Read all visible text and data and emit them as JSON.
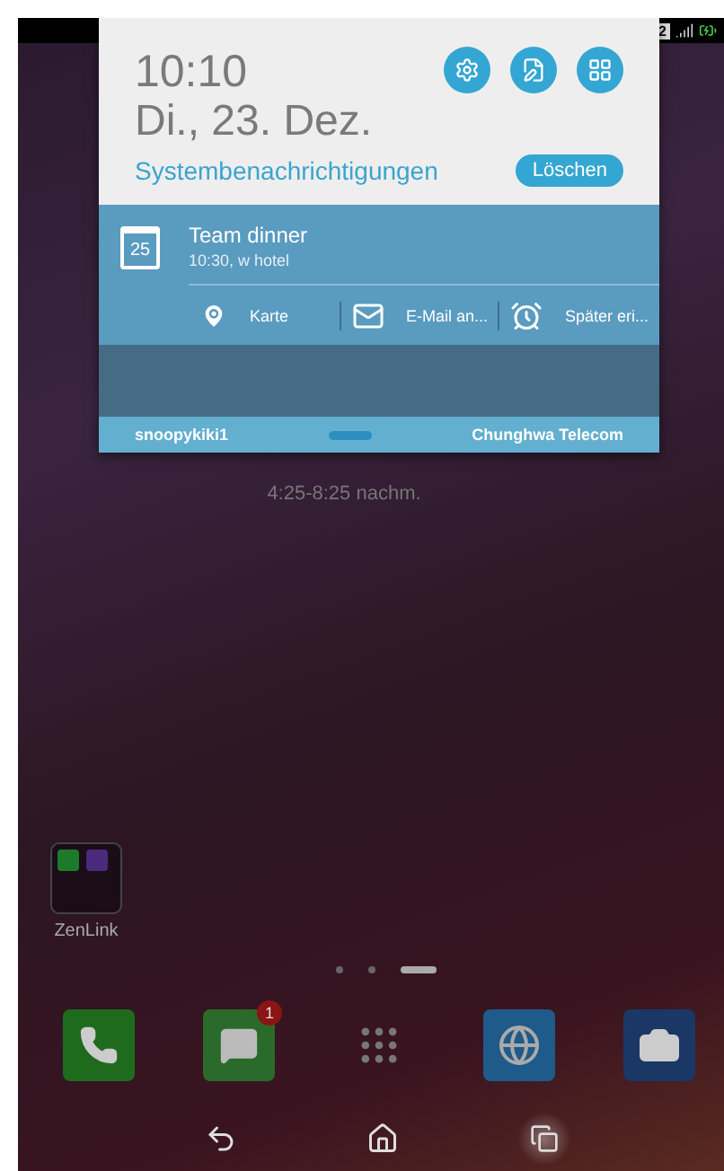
{
  "status_bar": {
    "sim_label": "2"
  },
  "panel": {
    "time": "10:10",
    "date": "Di., 23. Dez.",
    "section_title": "Systembenachrichtigungen",
    "clear_button": "Löschen",
    "notification": {
      "icon_day": "25",
      "title": "Team dinner",
      "subtitle": "10:30, w hotel",
      "actions": [
        {
          "kind": "map",
          "label": "Karte"
        },
        {
          "kind": "mail",
          "label": "E-Mail an..."
        },
        {
          "kind": "alarm",
          "label": "Später eri..."
        }
      ]
    },
    "footer": {
      "account": "snoopykiki1",
      "carrier": "Chunghwa Telecom"
    }
  },
  "home": {
    "widget_text": "4:25-8:25 nachm.",
    "folder": {
      "label": "ZenLink"
    },
    "pages": [
      {
        "selected": false
      },
      {
        "selected": false
      },
      {
        "selected": true
      }
    ],
    "dock": [
      {
        "kind": "phone"
      },
      {
        "kind": "messages",
        "badge": "1"
      },
      {
        "kind": "apps"
      },
      {
        "kind": "browser"
      },
      {
        "kind": "camera"
      }
    ]
  }
}
